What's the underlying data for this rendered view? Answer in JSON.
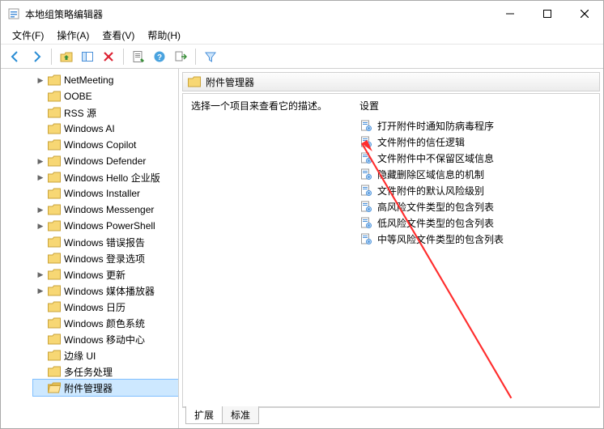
{
  "window": {
    "title": "本地组策略编辑器"
  },
  "menu": {
    "file": "文件(F)",
    "action": "操作(A)",
    "view": "查看(V)",
    "help": "帮助(H)"
  },
  "tree": {
    "items": [
      {
        "label": "NetMeeting",
        "expandable": true
      },
      {
        "label": "OOBE"
      },
      {
        "label": "RSS 源"
      },
      {
        "label": "Windows AI"
      },
      {
        "label": "Windows Copilot"
      },
      {
        "label": "Windows Defender",
        "expandable": true
      },
      {
        "label": "Windows Hello 企业版",
        "expandable": true
      },
      {
        "label": "Windows Installer"
      },
      {
        "label": "Windows Messenger",
        "expandable": true
      },
      {
        "label": "Windows PowerShell",
        "expandable": true
      },
      {
        "label": "Windows 错误报告"
      },
      {
        "label": "Windows 登录选项"
      },
      {
        "label": "Windows 更新",
        "expandable": true
      },
      {
        "label": "Windows 媒体播放器",
        "expandable": true
      },
      {
        "label": "Windows 日历"
      },
      {
        "label": "Windows 颜色系统"
      },
      {
        "label": "Windows 移动中心"
      },
      {
        "label": "边缘 UI"
      },
      {
        "label": "多任务处理"
      },
      {
        "label": "附件管理器",
        "selected": true
      }
    ]
  },
  "right": {
    "header": "附件管理器",
    "description": "选择一个项目来查看它的描述。",
    "settings_header": "设置",
    "settings": [
      "打开附件时通知防病毒程序",
      "文件附件的信任逻辑",
      "文件附件中不保留区域信息",
      "隐藏删除区域信息的机制",
      "文件附件的默认风险级别",
      "高风险文件类型的包含列表",
      "低风险文件类型的包含列表",
      "中等风险文件类型的包含列表"
    ]
  },
  "tabs": {
    "extended": "扩展",
    "standard": "标准"
  }
}
